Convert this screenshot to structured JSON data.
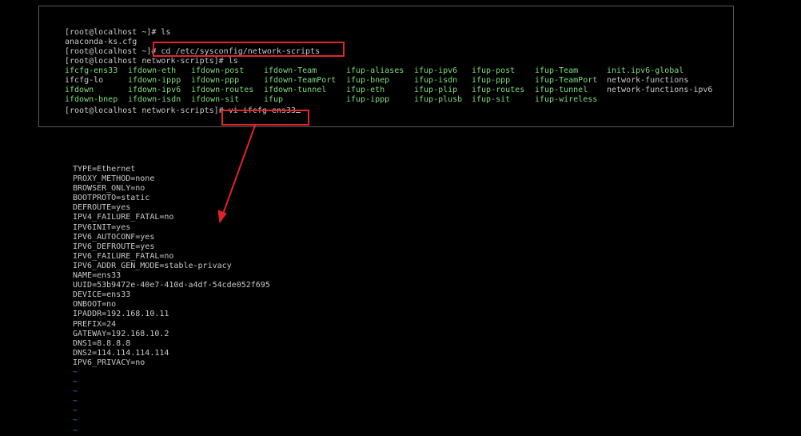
{
  "terminal": {
    "lines": [
      "[root@localhost ~]# ls",
      "anaconda-ks.cfg",
      "[root@localhost ~]# cd /etc/sysconfig/network-scripts",
      "[root@localhost network-scripts]# ls"
    ],
    "ls_rows": [
      [
        "ifcfg-ens33",
        "ifdown-eth",
        "ifdown-post",
        "ifdown-Team",
        "ifup-aliases",
        "ifup-ipv6",
        "ifup-post",
        "ifup-Team",
        "init.ipv6-global"
      ],
      [
        "ifcfg-lo",
        "ifdown-ippp",
        "ifdown-ppp",
        "ifdown-TeamPort",
        "ifup-bnep",
        "ifup-isdn",
        "ifup-ppp",
        "ifup-TeamPort",
        "network-functions"
      ],
      [
        "ifdown",
        "ifdown-ipv6",
        "ifdown-routes",
        "ifdown-tunnel",
        "ifup-eth",
        "ifup-plip",
        "ifup-routes",
        "ifup-tunnel",
        "network-functions-ipv6"
      ],
      [
        "ifdown-bnep",
        "ifdown-isdn",
        "ifdown-sit",
        "ifup",
        "ifup-ippp",
        "ifup-plusb",
        "ifup-sit",
        "ifup-wireless",
        ""
      ]
    ],
    "prompt_last": "[root@localhost network-scripts]# ",
    "command_last": "vi ifcfg-ens33"
  },
  "file": {
    "lines": [
      "TYPE=Ethernet",
      "PROXY_METHOD=none",
      "BROWSER_ONLY=no",
      "BOOTPROTO=static",
      "DEFROUTE=yes",
      "IPV4_FAILURE_FATAL=no",
      "IPV6INIT=yes",
      "IPV6_AUTOCONF=yes",
      "IPV6_DEFROUTE=yes",
      "IPV6_FAILURE_FATAL=no",
      "IPV6_ADDR_GEN_MODE=stable-privacy",
      "NAME=ens33",
      "UUID=53b9472e-40e7-410d-a4df-54cde052f695",
      "DEVICE=ens33",
      "ONBOOT=no",
      "IPADDR=192.168.10.11",
      "PREFIX=24",
      "GATEWAY=192.168.10.2",
      "DNS1=8.8.8.8",
      "DNS2=114.114.114.114",
      "IPV6_PRIVACY=no"
    ],
    "tilde": "~"
  },
  "colors": {
    "annotation": "#e0252a",
    "executable": "#7fdc7f",
    "text": "#c8c8c8",
    "tilde": "#4f6fe0"
  }
}
